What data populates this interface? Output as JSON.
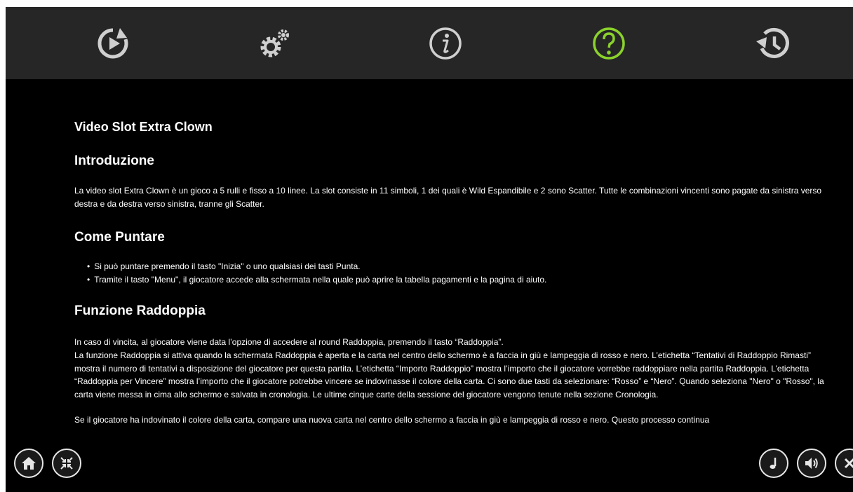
{
  "toolbar": {
    "icons": [
      "replay-icon",
      "settings-icon",
      "info-icon",
      "help-icon",
      "history-icon"
    ],
    "active": "help-icon",
    "accent_color": "#8bd22b"
  },
  "content": {
    "title": "Video Slot Extra Clown",
    "sections": {
      "intro": {
        "heading": "Introduzione",
        "text": "La video slot Extra Clown è un gioco a 5 rulli e fisso a 10 linee. La slot consiste in 11 simboli, 1 dei quali è Wild Espandibile e 2 sono Scatter. Tutte le combinazioni vincenti sono pagate da sinistra verso destra e da destra verso sinistra, tranne gli Scatter."
      },
      "bet": {
        "heading": "Come Puntare",
        "items": [
          "Si può puntare premendo il tasto \"Inizia\" o uno qualsiasi dei tasti Punta.",
          "Tramite il tasto \"Menu\", il giocatore accede alla schermata nella quale può aprire la tabella pagamenti e la pagina di aiuto."
        ]
      },
      "double": {
        "heading": "Funzione Raddoppia",
        "p1": "In caso di vincita, al giocatore viene data l’opzione di accedere al round Raddoppia, premendo il tasto “Raddoppia”.",
        "p2": "La funzione Raddoppia si attiva quando la schermata Raddoppia è aperta e la carta nel centro dello schermo è a faccia in giù e lampeggia di rosso e nero. L’etichetta “Tentativi di Raddoppio Rimasti” mostra il numero di tentativi a disposizione del giocatore per questa partita. L’etichetta “Importo Raddoppio” mostra l’importo che il giocatore vorrebbe raddoppiare nella partita Raddoppia. L’etichetta “Raddoppia per Vincere” mostra l’importo che il giocatore potrebbe vincere se indovinasse il colore della carta. Ci sono due tasti da selezionare: “Rosso” e “Nero”. Quando seleziona \"Nero\" o \"Rosso\", la carta viene messa in cima allo schermo e salvata in cronologia. Le ultime cinque carte della sessione del giocatore vengono tenute nella sezione Cronologia.",
        "p3": "Se il giocatore ha indovinato il colore della carta, compare una nuova carta nel centro dello schermo a faccia in giù e lampeggia di rosso e nero. Questo processo continua"
      }
    }
  },
  "bottom": {
    "left": [
      "home-icon",
      "exit-fullscreen-icon"
    ],
    "right": [
      "music-icon",
      "sound-icon",
      "close-icon"
    ]
  }
}
